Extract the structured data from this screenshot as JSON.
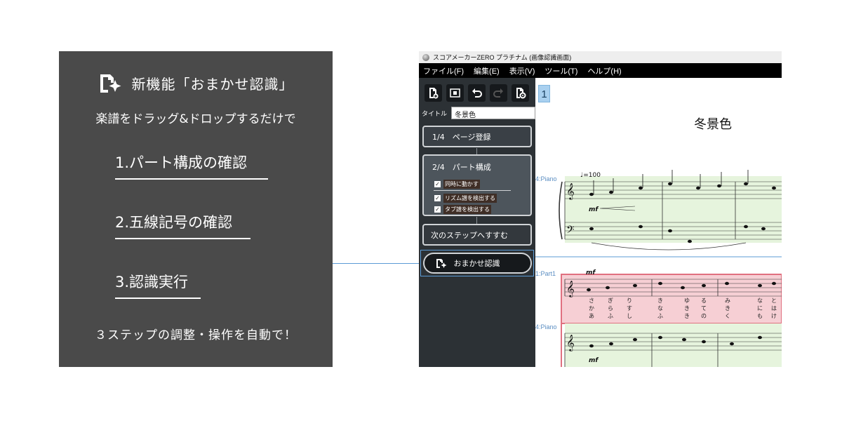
{
  "promo": {
    "title": "新機能「おまかせ認識」",
    "subtitle": "楽譜をドラッグ&ドロップするだけで",
    "steps": [
      "1.パート構成の確認",
      "2.五線記号の確認",
      "3.認識実行"
    ],
    "footer": "３ステップの調整・操作を自動で！"
  },
  "app": {
    "window_title": "スコアメーカーZERO プラチナム (画像認識画面)",
    "menu": [
      "ファイル(F)",
      "編集(E)",
      "表示(V)",
      "ツール(T)",
      "ヘルプ(H)"
    ],
    "toolbar_icons": [
      "add-page-icon",
      "scan-icon",
      "undo-icon",
      "redo-icon",
      "settings-icon"
    ],
    "title_label": "タイトル",
    "title_value": "冬景色",
    "step1": "1/4　ページ登録",
    "step2": {
      "header": "2/4　パート構成",
      "checkboxes": [
        {
          "label": "同時に動かす",
          "checked": true
        },
        {
          "label": "リズム譜を検出する",
          "checked": true
        },
        {
          "label": "タブ譜を検出する",
          "checked": true
        }
      ]
    },
    "next_step": "次のステップへすすむ",
    "omakase_button": "おまかせ認識"
  },
  "score": {
    "page_number": "1",
    "title": "冬景色",
    "tempo": "♩=100",
    "dynamic": "mf",
    "parts": [
      "4:Piano",
      "1:Part1",
      "4:Piano"
    ],
    "lyrics_row1": [
      "さ",
      "ぎ",
      "り",
      "き",
      "ゆ",
      "る",
      "み",
      "な",
      "と"
    ],
    "lyrics_row2": [
      "か",
      "ら",
      "す",
      "な",
      "き",
      "て",
      "き",
      "に",
      "は"
    ],
    "lyrics_row3": [
      "あ",
      "ふ",
      "し",
      "ふ",
      "き",
      "の",
      "く",
      "も",
      "け"
    ]
  },
  "colors": {
    "panel_bg": "#4a4a4a",
    "connector": "#5b9bd5",
    "piano_highlight": "#e6f4dd",
    "part_highlight": "#f6cfd4"
  }
}
